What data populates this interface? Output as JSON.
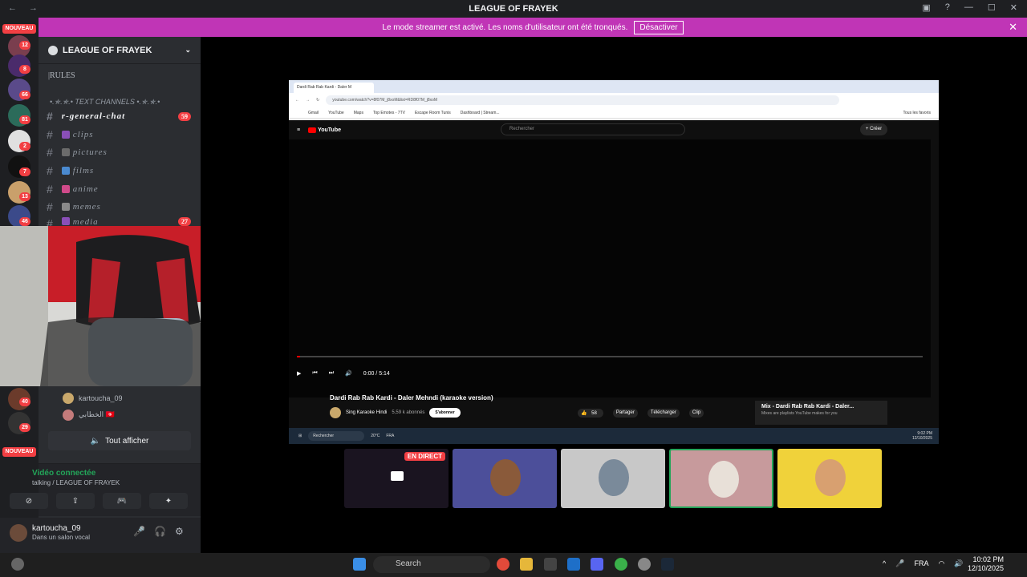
{
  "app": {
    "title": "LEAGUE OF FRAYEK",
    "nav": "← →"
  },
  "banner": {
    "message": "Le mode streamer est activé. Les noms d'utilisateur ont été tronqués.",
    "button": "Désactiver",
    "close": "✕"
  },
  "servers": {
    "nouveau_top": "NOUVEAU",
    "nouveau_bottom": "NOUVEAU",
    "badges": [
      "12",
      "8",
      "66",
      "81",
      "2",
      "7",
      "13",
      "46",
      "40",
      "29"
    ]
  },
  "guild": {
    "name": "LEAGUE OF FRAYEK",
    "rules": "|RULES",
    "category": "•.✯.✯.• TEXT CHANNELS •.✯.✯.•",
    "channels": [
      {
        "name": "r-general-chat",
        "badge": "59"
      },
      {
        "name": "clips"
      },
      {
        "name": "pictures"
      },
      {
        "name": "films"
      },
      {
        "name": "anime"
      },
      {
        "name": "memes"
      },
      {
        "name": "media",
        "badge": "27"
      }
    ]
  },
  "voice_users": [
    {
      "name": "kartoucha_09"
    },
    {
      "name": "الخطابي 🇹🇳"
    }
  ],
  "show_all": "Tout afficher",
  "voice": {
    "status": "Vidéo connectée",
    "channel": "talking / LEAGUE OF FRAYEK"
  },
  "user": {
    "name": "kartoucha_09",
    "status": "Dans un salon vocal"
  },
  "browser": {
    "tab_title": "Dardi Rab Rab Kardi - Daler M",
    "url": "youtube.com/watch?v=8f07M_j8xoM&list=RD8f07M_j8xoM",
    "bookmarks": [
      "Gmail",
      "YouTube",
      "Maps",
      "Top Emotes - 7TV",
      "Escape Room Tunis",
      "Dashboard | Stream..."
    ],
    "all_bookmarks": "Tous les favoris"
  },
  "youtube": {
    "logo": "YouTube",
    "search_placeholder": "Rechercher",
    "create": "+ Créer",
    "time": "0:00 / 5:14",
    "progress": 0.005,
    "video_title": "Dardi Rab Rab Kardi - Daler Mehndi (karaoke version)",
    "channel": "Sing Karaoke Hindi",
    "subscribers": "5,59 k abonnés",
    "subscribe": "S'abonner",
    "likes": "58",
    "share": "Partager",
    "download": "Télécharger",
    "clip": "Clip",
    "mix_title": "Mix - Dardi Rab Rab Kardi - Daler...",
    "mix_sub": "Mixes are playlists YouTube makes for you"
  },
  "inner_taskbar": {
    "search": "Rechercher",
    "temp": "20°C",
    "time": "9:02 PM",
    "date": "12/10/2025",
    "lang": "FRA"
  },
  "tiles": {
    "live": "EN DIRECT"
  },
  "taskbar": {
    "search": "Search",
    "lang": "FRA",
    "time": "10:02 PM",
    "date": "12/10/2025"
  },
  "colors": {
    "banner": "#c035b6",
    "live": "#f23f43",
    "connected": "#23a559"
  }
}
